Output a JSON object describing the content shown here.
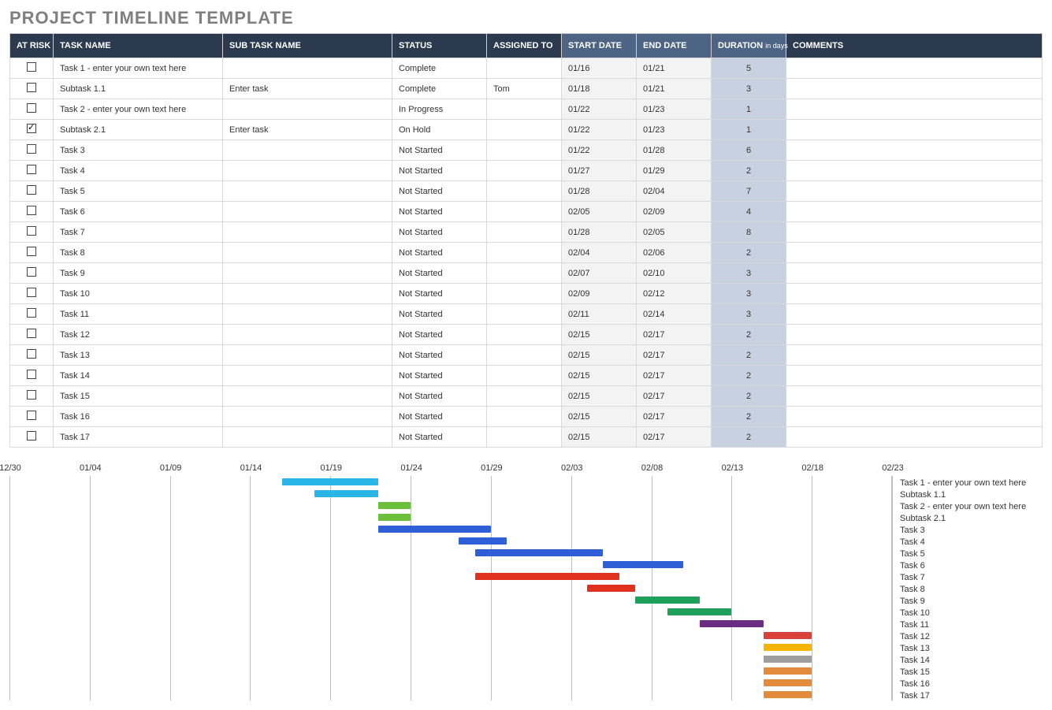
{
  "title": "PROJECT TIMELINE TEMPLATE",
  "columns": {
    "risk": "AT RISK",
    "task": "TASK NAME",
    "sub": "SUB TASK NAME",
    "status": "STATUS",
    "assigned": "ASSIGNED TO",
    "start": "START DATE",
    "end": "END DATE",
    "duration": "DURATION",
    "duration_unit": "in days",
    "comments": "COMMENTS"
  },
  "rows": [
    {
      "risk": false,
      "task": "Task 1 - enter your own text here",
      "sub": "",
      "status": "Complete",
      "assigned": "",
      "start": "01/16",
      "end": "01/21",
      "duration": "5",
      "comments": ""
    },
    {
      "risk": false,
      "task": "Subtask 1.1",
      "sub": "Enter task",
      "status": "Complete",
      "assigned": "Tom",
      "start": "01/18",
      "end": "01/21",
      "duration": "3",
      "comments": ""
    },
    {
      "risk": false,
      "task": "Task 2 - enter your own text here",
      "sub": "",
      "status": "In Progress",
      "assigned": "",
      "start": "01/22",
      "end": "01/23",
      "duration": "1",
      "comments": ""
    },
    {
      "risk": true,
      "task": "Subtask 2.1",
      "sub": "Enter task",
      "status": "On Hold",
      "assigned": "",
      "start": "01/22",
      "end": "01/23",
      "duration": "1",
      "comments": ""
    },
    {
      "risk": false,
      "task": "Task 3",
      "sub": "",
      "status": "Not Started",
      "assigned": "",
      "start": "01/22",
      "end": "01/28",
      "duration": "6",
      "comments": ""
    },
    {
      "risk": false,
      "task": "Task 4",
      "sub": "",
      "status": "Not Started",
      "assigned": "",
      "start": "01/27",
      "end": "01/29",
      "duration": "2",
      "comments": ""
    },
    {
      "risk": false,
      "task": "Task 5",
      "sub": "",
      "status": "Not Started",
      "assigned": "",
      "start": "01/28",
      "end": "02/04",
      "duration": "7",
      "comments": ""
    },
    {
      "risk": false,
      "task": "Task 6",
      "sub": "",
      "status": "Not Started",
      "assigned": "",
      "start": "02/05",
      "end": "02/09",
      "duration": "4",
      "comments": ""
    },
    {
      "risk": false,
      "task": "Task 7",
      "sub": "",
      "status": "Not Started",
      "assigned": "",
      "start": "01/28",
      "end": "02/05",
      "duration": "8",
      "comments": ""
    },
    {
      "risk": false,
      "task": "Task 8",
      "sub": "",
      "status": "Not Started",
      "assigned": "",
      "start": "02/04",
      "end": "02/06",
      "duration": "2",
      "comments": ""
    },
    {
      "risk": false,
      "task": "Task 9",
      "sub": "",
      "status": "Not Started",
      "assigned": "",
      "start": "02/07",
      "end": "02/10",
      "duration": "3",
      "comments": ""
    },
    {
      "risk": false,
      "task": "Task 10",
      "sub": "",
      "status": "Not Started",
      "assigned": "",
      "start": "02/09",
      "end": "02/12",
      "duration": "3",
      "comments": ""
    },
    {
      "risk": false,
      "task": "Task 11",
      "sub": "",
      "status": "Not Started",
      "assigned": "",
      "start": "02/11",
      "end": "02/14",
      "duration": "3",
      "comments": ""
    },
    {
      "risk": false,
      "task": "Task 12",
      "sub": "",
      "status": "Not Started",
      "assigned": "",
      "start": "02/15",
      "end": "02/17",
      "duration": "2",
      "comments": ""
    },
    {
      "risk": false,
      "task": "Task 13",
      "sub": "",
      "status": "Not Started",
      "assigned": "",
      "start": "02/15",
      "end": "02/17",
      "duration": "2",
      "comments": ""
    },
    {
      "risk": false,
      "task": "Task 14",
      "sub": "",
      "status": "Not Started",
      "assigned": "",
      "start": "02/15",
      "end": "02/17",
      "duration": "2",
      "comments": ""
    },
    {
      "risk": false,
      "task": "Task 15",
      "sub": "",
      "status": "Not Started",
      "assigned": "",
      "start": "02/15",
      "end": "02/17",
      "duration": "2",
      "comments": ""
    },
    {
      "risk": false,
      "task": "Task 16",
      "sub": "",
      "status": "Not Started",
      "assigned": "",
      "start": "02/15",
      "end": "02/17",
      "duration": "2",
      "comments": ""
    },
    {
      "risk": false,
      "task": "Task 17",
      "sub": "",
      "status": "Not Started",
      "assigned": "",
      "start": "02/15",
      "end": "02/17",
      "duration": "2",
      "comments": ""
    }
  ],
  "chart_data": {
    "type": "bar",
    "orientation": "horizontal-gantt",
    "x_ticks": [
      "12/30",
      "01/04",
      "01/09",
      "01/14",
      "01/19",
      "01/24",
      "01/29",
      "02/03",
      "02/08",
      "02/13",
      "02/18",
      "02/23"
    ],
    "x_start": "12/30",
    "x_end": "02/23",
    "day_span": 55,
    "series": [
      {
        "name": "Task 1 - enter your own text here",
        "start": "01/16",
        "end": "01/21",
        "color": "#29b6e6"
      },
      {
        "name": "Subtask 1.1",
        "start": "01/18",
        "end": "01/21",
        "color": "#29b6e6"
      },
      {
        "name": "Task 2 - enter your own text here",
        "start": "01/22",
        "end": "01/23",
        "color": "#6bbf3b"
      },
      {
        "name": "Subtask 2.1",
        "start": "01/22",
        "end": "01/23",
        "color": "#6bbf3b"
      },
      {
        "name": "Task 3",
        "start": "01/22",
        "end": "01/28",
        "color": "#2f5fd8"
      },
      {
        "name": "Task 4",
        "start": "01/27",
        "end": "01/29",
        "color": "#2f5fd8"
      },
      {
        "name": "Task 5",
        "start": "01/28",
        "end": "02/04",
        "color": "#2f5fd8"
      },
      {
        "name": "Task 6",
        "start": "02/05",
        "end": "02/09",
        "color": "#2f5fd8"
      },
      {
        "name": "Task 7",
        "start": "01/28",
        "end": "02/05",
        "color": "#e0301e"
      },
      {
        "name": "Task 8",
        "start": "02/04",
        "end": "02/06",
        "color": "#e0301e"
      },
      {
        "name": "Task 9",
        "start": "02/07",
        "end": "02/10",
        "color": "#1fa05a"
      },
      {
        "name": "Task 10",
        "start": "02/09",
        "end": "02/12",
        "color": "#1fa05a"
      },
      {
        "name": "Task 11",
        "start": "02/11",
        "end": "02/14",
        "color": "#6a2d82"
      },
      {
        "name": "Task 12",
        "start": "02/15",
        "end": "02/17",
        "color": "#d9423a"
      },
      {
        "name": "Task 13",
        "start": "02/15",
        "end": "02/17",
        "color": "#f4b400"
      },
      {
        "name": "Task 14",
        "start": "02/15",
        "end": "02/17",
        "color": "#9e9e9e"
      },
      {
        "name": "Task 15",
        "start": "02/15",
        "end": "02/17",
        "color": "#e38b3d"
      },
      {
        "name": "Task 16",
        "start": "02/15",
        "end": "02/17",
        "color": "#e38b3d"
      },
      {
        "name": "Task 17",
        "start": "02/15",
        "end": "02/17",
        "color": "#e38b3d"
      }
    ]
  }
}
